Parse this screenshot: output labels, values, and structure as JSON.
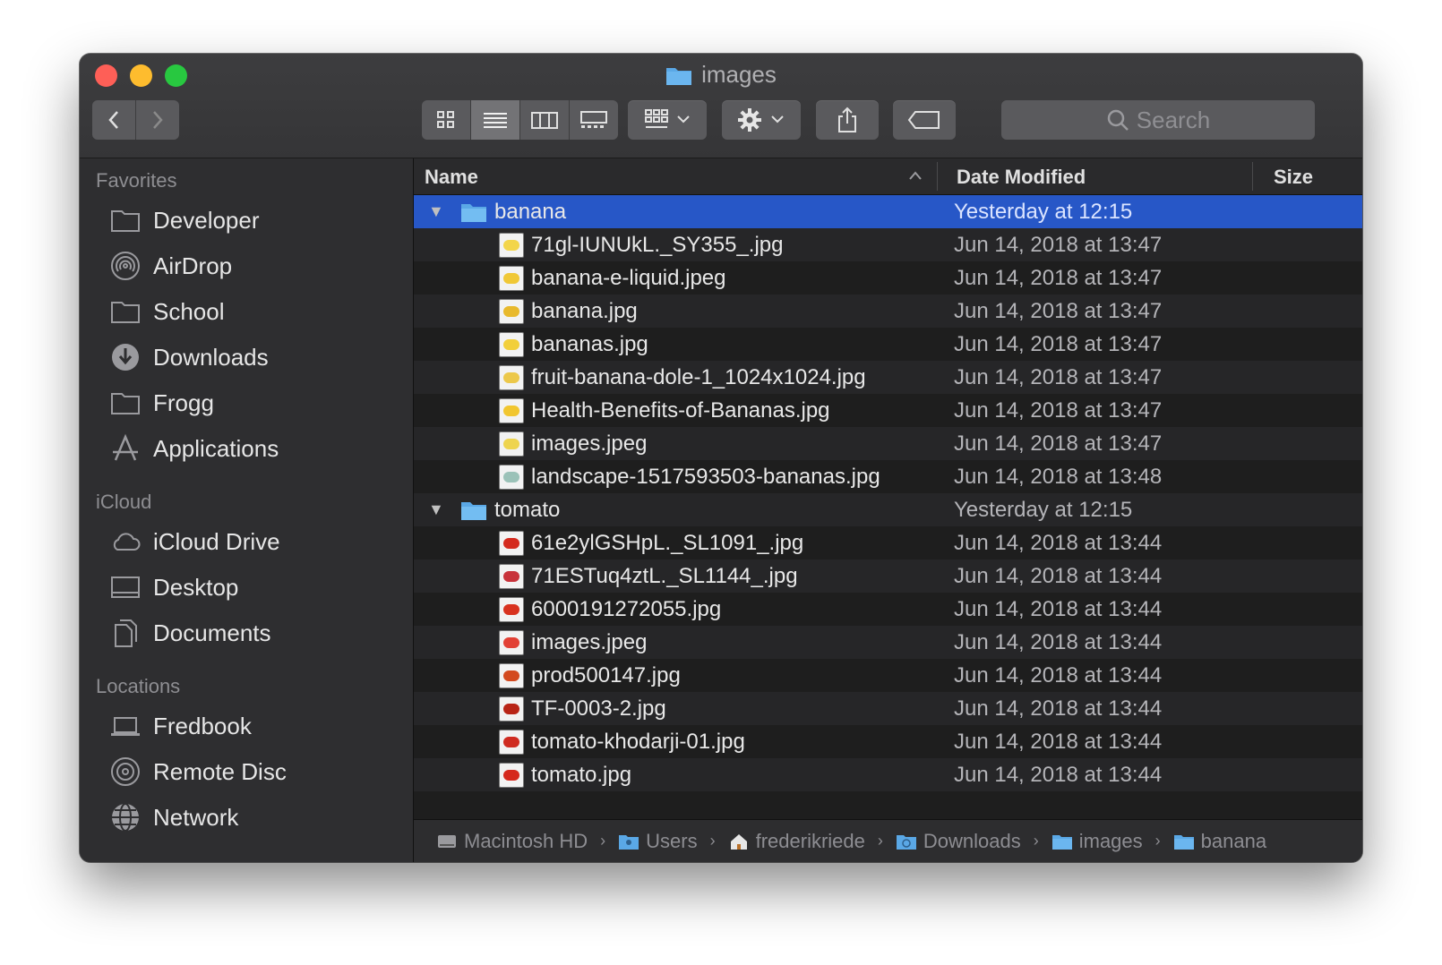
{
  "window": {
    "title": "images"
  },
  "toolbar": {
    "back": "back",
    "forward": "forward",
    "view_modes": [
      "icon-view",
      "list-view",
      "column-view",
      "gallery-view"
    ],
    "active_view": "list-view",
    "group_button": "group",
    "action_button": "action",
    "share_button": "share",
    "tags_button": "tags",
    "search_placeholder": "Search"
  },
  "sidebar": {
    "sections": [
      {
        "title": "Favorites",
        "items": [
          {
            "label": "Developer",
            "icon": "folder-icon"
          },
          {
            "label": "AirDrop",
            "icon": "airdrop-icon"
          },
          {
            "label": "School",
            "icon": "folder-icon"
          },
          {
            "label": "Downloads",
            "icon": "downloads-icon"
          },
          {
            "label": "Frogg",
            "icon": "folder-icon"
          },
          {
            "label": "Applications",
            "icon": "applications-icon"
          }
        ]
      },
      {
        "title": "iCloud",
        "items": [
          {
            "label": "iCloud Drive",
            "icon": "cloud-icon"
          },
          {
            "label": "Desktop",
            "icon": "desktop-icon"
          },
          {
            "label": "Documents",
            "icon": "documents-icon"
          }
        ]
      },
      {
        "title": "Locations",
        "items": [
          {
            "label": "Fredbook",
            "icon": "laptop-icon"
          },
          {
            "label": "Remote Disc",
            "icon": "disc-icon"
          },
          {
            "label": "Network",
            "icon": "network-icon"
          }
        ]
      }
    ]
  },
  "columns": {
    "name": "Name",
    "date": "Date Modified",
    "size": "Size"
  },
  "rows": [
    {
      "type": "folder",
      "name": "banana",
      "date": "Yesterday at 12:15",
      "selected": true
    },
    {
      "type": "file",
      "name": "71gl-IUNUkL._SY355_.jpg",
      "date": "Jun 14, 2018 at 13:47",
      "thumb": "#f3d54a"
    },
    {
      "type": "file",
      "name": "banana-e-liquid.jpeg",
      "date": "Jun 14, 2018 at 13:47",
      "thumb": "#f0c836"
    },
    {
      "type": "file",
      "name": "banana.jpg",
      "date": "Jun 14, 2018 at 13:47",
      "thumb": "#e8b92c"
    },
    {
      "type": "file",
      "name": "bananas.jpg",
      "date": "Jun 14, 2018 at 13:47",
      "thumb": "#f2cf3a"
    },
    {
      "type": "file",
      "name": "fruit-banana-dole-1_1024x1024.jpg",
      "date": "Jun 14, 2018 at 13:47",
      "thumb": "#ecc84a"
    },
    {
      "type": "file",
      "name": "Health-Benefits-of-Bananas.jpg",
      "date": "Jun 14, 2018 at 13:47",
      "thumb": "#f1c62f"
    },
    {
      "type": "file",
      "name": "images.jpeg",
      "date": "Jun 14, 2018 at 13:47",
      "thumb": "#eed44e"
    },
    {
      "type": "file",
      "name": "landscape-1517593503-bananas.jpg",
      "date": "Jun 14, 2018 at 13:48",
      "thumb": "#9bc2b8"
    },
    {
      "type": "folder",
      "name": "tomato",
      "date": "Yesterday at 12:15",
      "selected": false
    },
    {
      "type": "file",
      "name": "61e2ylGSHpL._SL1091_.jpg",
      "date": "Jun 14, 2018 at 13:44",
      "thumb": "#d42a1e"
    },
    {
      "type": "file",
      "name": "71ESTuq4ztL._SL1144_.jpg",
      "date": "Jun 14, 2018 at 13:44",
      "thumb": "#c8323a"
    },
    {
      "type": "file",
      "name": "6000191272055.jpg",
      "date": "Jun 14, 2018 at 13:44",
      "thumb": "#d8321f"
    },
    {
      "type": "file",
      "name": "images.jpeg",
      "date": "Jun 14, 2018 at 13:44",
      "thumb": "#e24034"
    },
    {
      "type": "file",
      "name": "prod500147.jpg",
      "date": "Jun 14, 2018 at 13:44",
      "thumb": "#d3491e"
    },
    {
      "type": "file",
      "name": "TF-0003-2.jpg",
      "date": "Jun 14, 2018 at 13:44",
      "thumb": "#b82416"
    },
    {
      "type": "file",
      "name": "tomato-khodarji-01.jpg",
      "date": "Jun 14, 2018 at 13:44",
      "thumb": "#cf2b20"
    },
    {
      "type": "file",
      "name": "tomato.jpg",
      "date": "Jun 14, 2018 at 13:44",
      "thumb": "#d5281d"
    }
  ],
  "pathbar": [
    {
      "label": "Macintosh HD",
      "icon": "hard-drive-icon"
    },
    {
      "label": "Users",
      "icon": "users-folder-icon"
    },
    {
      "label": "frederikriede",
      "icon": "home-icon"
    },
    {
      "label": "Downloads",
      "icon": "downloads-folder-icon"
    },
    {
      "label": "images",
      "icon": "folder-icon"
    },
    {
      "label": "banana",
      "icon": "folder-icon"
    }
  ]
}
